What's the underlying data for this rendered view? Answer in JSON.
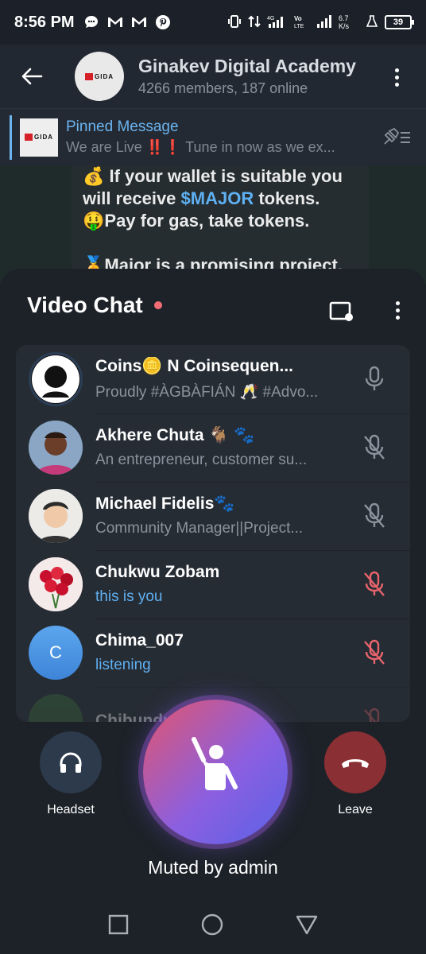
{
  "status_bar": {
    "time": "8:56 PM",
    "net_speed": "6.7 K/s",
    "battery": "39"
  },
  "header": {
    "title": "Ginakev Digital Academy",
    "subtitle": "4266 members, 187 online",
    "avatar_logo_text": "GIDA"
  },
  "pinned": {
    "title": "Pinned Message",
    "body": "We are Live ‼️❗  Tune in now as we ex...",
    "thumb_text": "GIDA"
  },
  "chat_bubble": {
    "line1": "💰 If your wallet is suitable you",
    "line2_pre": "will receive ",
    "line2_link": "$MAJOR",
    "line2_post": " tokens.",
    "line3": "🤑Pay for gas, take tokens.",
    "line4": "🏅Major is a promising project,"
  },
  "video_chat": {
    "title": "Video Chat",
    "participants": [
      {
        "name": "Coins🪙 N Coinsequen...",
        "about": "Proudly #ÀGBÀFIÁN 🥂 #Advo...",
        "mic": "on"
      },
      {
        "name": "Akhere Chuta 🐐 🐾",
        "about": "An entrepreneur, customer su...",
        "mic": "muted"
      },
      {
        "name": "Michael Fidelis🐾",
        "about": "Community Manager||Project...",
        "mic": "muted"
      },
      {
        "name": "Chukwu Zobam",
        "about": "this is you",
        "mic": "muted-red"
      },
      {
        "name": "Chima_007",
        "about": "listening",
        "mic": "muted-red",
        "initial": "C"
      },
      {
        "name": "Chibundu",
        "about": "",
        "mic": "muted-red"
      }
    ]
  },
  "controls": {
    "headset_label": "Headset",
    "leave_label": "Leave",
    "status": "Muted by admin"
  },
  "colors": {
    "accent_blue": "#5fb0f2",
    "muted_red": "#e9646c",
    "leave_red": "#8a2f33"
  }
}
